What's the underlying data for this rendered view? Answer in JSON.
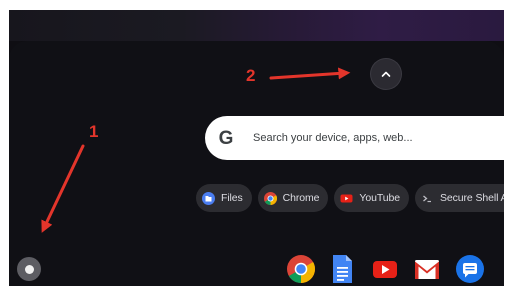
{
  "annotations": {
    "label_1": "1",
    "label_2": "2"
  },
  "search": {
    "placeholder": "Search your device, apps, web..."
  },
  "app_chips": [
    {
      "label": "Files",
      "icon": "files-icon"
    },
    {
      "label": "Chrome",
      "icon": "chrome-icon"
    },
    {
      "label": "YouTube",
      "icon": "youtube-icon"
    },
    {
      "label": "Secure Shell App",
      "icon": "terminal-icon"
    },
    {
      "label": "",
      "icon": "red-app-icon"
    }
  ],
  "shelf": {
    "apps": [
      "chrome-icon",
      "docs-icon",
      "youtube-icon",
      "gmail-icon",
      "messages-icon"
    ]
  },
  "colors": {
    "annotation": "#e3352b",
    "chip_background": "#2c2c31",
    "panel_background": "#101015"
  }
}
